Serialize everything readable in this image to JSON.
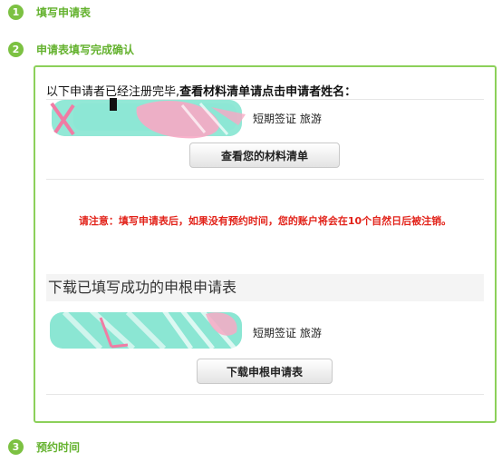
{
  "steps": [
    {
      "number": "1",
      "label": "填写申请表"
    },
    {
      "number": "2",
      "label": "申请表填写完成确认"
    },
    {
      "number": "3",
      "label": "预约时间"
    }
  ],
  "confirmation": {
    "intro_plain": "以下申请者已经注册完毕,",
    "intro_bold": "查看材料清单请点击申请者姓名：",
    "applicant_visa_1": "短期签证 旅游",
    "view_materials_button": "查看您的材料清单",
    "notice": "请注意：填写申请表后，如果没有预约时间，您的账户将会在10个自然日后被注销。",
    "download_title": "下载已填写成功的申根申请表",
    "applicant_visa_2": "短期签证 旅游",
    "download_button": "下载申根申请表"
  },
  "colors": {
    "accent_green": "#7cc142",
    "step_label_green": "#64b22e",
    "panel_border": "#8cd05a",
    "notice_red": "#e2231a"
  }
}
